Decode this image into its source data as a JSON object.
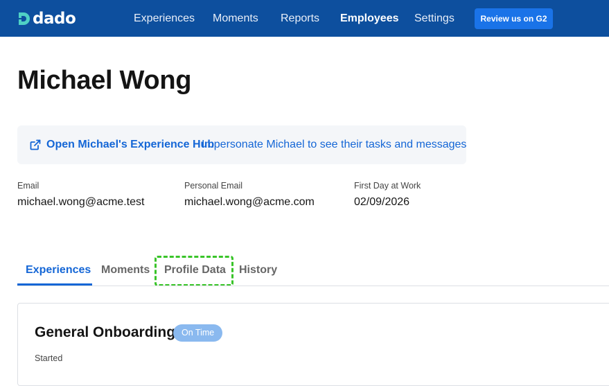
{
  "brand": {
    "name": "dado",
    "icon": "dado-logo-icon"
  },
  "nav": {
    "items": [
      {
        "label": "Experiences",
        "active": false
      },
      {
        "label": "Moments",
        "active": false
      },
      {
        "label": "Reports",
        "active": false
      },
      {
        "label": "Employees",
        "active": true
      },
      {
        "label": "Settings",
        "active": false
      }
    ],
    "review_button": "Review us on G2"
  },
  "employee": {
    "name": "Michael Wong",
    "hub_link": "Open Michael's Experience Hub",
    "hub_description": "Impersonate Michael to see their tasks and messages",
    "hub_icon": "external-link-icon",
    "fields": [
      {
        "label": "Email",
        "value": "michael.wong@acme.test"
      },
      {
        "label": "Personal Email",
        "value": "michael.wong@acme.com"
      },
      {
        "label": "First Day at Work",
        "value": "02/09/2026"
      }
    ]
  },
  "tabs": [
    {
      "label": "Experiences",
      "active": true
    },
    {
      "label": "Moments",
      "active": false
    },
    {
      "label": "Profile Data",
      "active": false,
      "focused": true
    },
    {
      "label": "History",
      "active": false
    }
  ],
  "experience_card": {
    "title": "General Onboarding",
    "status": "On Time",
    "started_label": "Started"
  },
  "colors": {
    "nav_bg": "#0d4f9e",
    "accent": "#1466d6",
    "button_bg": "#1a73e8",
    "badge_bg": "#8ab9ef",
    "focus_outline": "#39c429"
  }
}
